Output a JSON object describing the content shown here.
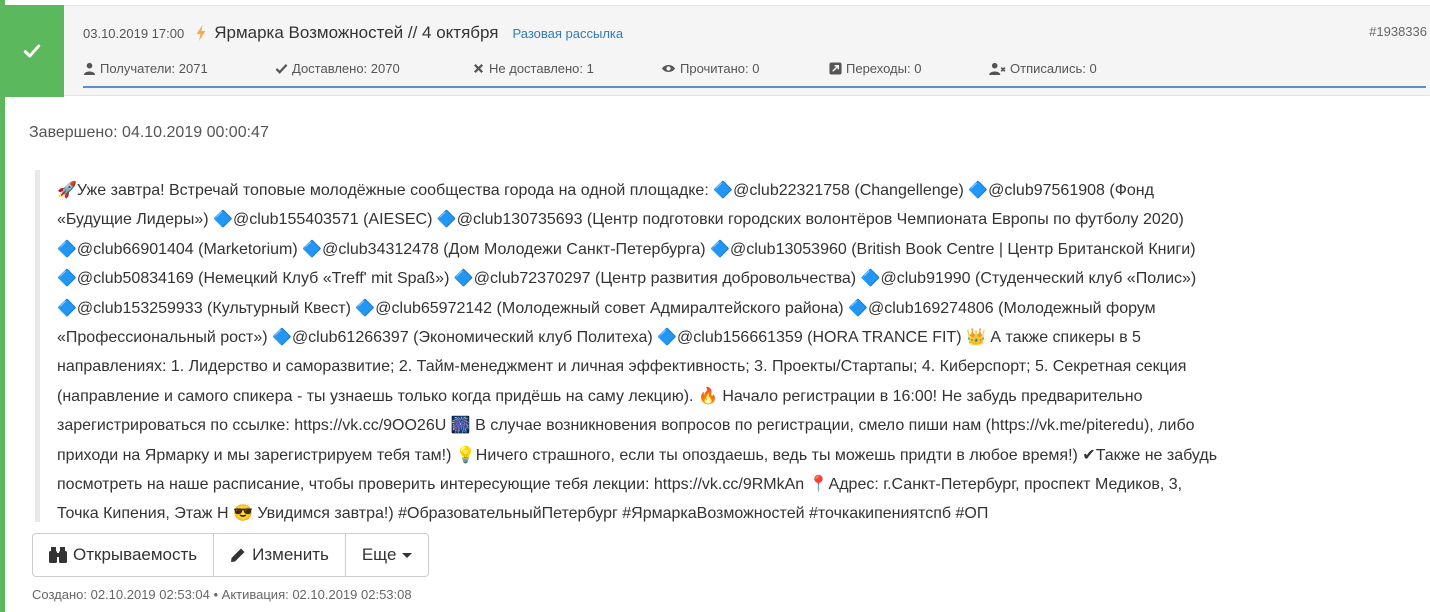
{
  "header": {
    "date": "03.10.2019 17:00",
    "title": "Ярмарка Возможностей // 4 октября",
    "type_link": "Разовая рассылка",
    "message_id": "#1938336",
    "status_color": "#5cb85c"
  },
  "stats": {
    "recipients": "Получатели: 2071",
    "delivered": "Доставлено: 2070",
    "not_delivered": "Не доставлено: 1",
    "read": "Прочитано: 0",
    "clicks": "Переходы: 0",
    "unsubscribed": "Отписались: 0"
  },
  "finished": "Завершено: 04.10.2019 00:00:47",
  "message_lines": [
    "🚀Уже завтра! Встречай топовые молодёжные сообщества города на одной площадке: 🔷@club22321758 (Changellenge) 🔷@club97561908 (Фонд",
    "«Будущие Лидеры») 🔷@club155403571 (AIESEC) 🔷@club130735693 (Центр подготовки городских волонтёров Чемпионата Европы по футболу 2020)",
    "🔷@club66901404 (Marketorium) 🔷@club34312478 (Дом Молодежи Санкт-Петербурга) 🔷@club13053960 (British Book Centre | Центр Британской Книги)",
    "🔷@club50834169 (Немецкий Клуб «Treff' mit Spaß») 🔷@club72370297 (Центр развития добровольчества) 🔷@club91990 (Студенческий клуб «Полис»)",
    "🔷@club153259933 (Культурный Квест) 🔷@club65972142 (Молодежный совет Адмиралтейского района) 🔷@club169274806 (Молодежный форум",
    "«Профессиональный рост») 🔷@club61266397 (Экономический клуб Политеха) 🔷@club156661359 (HORA TRANCE FIT) 👑 А также спикеры в 5",
    "направлениях: 1. Лидерство и саморазвитие; 2. Тайм-менеджмент и личная эффективность; 3. Проекты/Стартапы; 4. Киберспорт; 5. Секретная секция",
    "(направление и самого спикера - ты узнаешь только когда придёшь на саму лекцию). 🔥 Начало регистрации в 16:00! Не забудь предварительно",
    "зарегистрироваться по ссылке: https://vk.cc/9OO26U 🎆 В случае возникновения вопросов по регистрации, смело пиши нам (https://vk.me/piteredu), либо",
    "приходи на Ярмарку и мы зарегистрируем тебя там!) 💡Ничего страшного, если ты опоздаешь, ведь ты можешь придти в любое время!) ✔Также не забудь",
    "посмотреть на наше расписание, чтобы проверить интересующие тебя лекции: https://vk.cc/9RMkAn 📍Адрес: г.Санкт-Петербург, проспект Медиков, 3,",
    "Точка Кипения, Этаж Н 😎 Увидимся завтра!) #ОбразовательныйПетербург #ЯрмаркаВозможностей #точкакипениятспб #ОП"
  ],
  "buttons": {
    "open_rate": "Открываемость",
    "edit": "Изменить",
    "more": "Еще"
  },
  "footer": "Создано: 02.10.2019 02:53:04 • Активация: 02.10.2019 02:53:08"
}
